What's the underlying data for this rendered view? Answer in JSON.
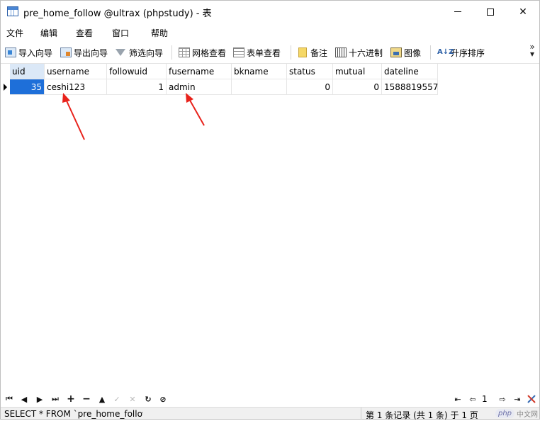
{
  "window": {
    "title": "pre_home_follow @ultrax (phpstudy) - 表",
    "minimize_icon": "minimize-icon",
    "maximize_icon": "maximize-icon",
    "close_glyph": "✕"
  },
  "menu": [
    "文件",
    "编辑",
    "查看",
    "窗口",
    "帮助"
  ],
  "toolbar": {
    "import": "导入向导",
    "export": "导出向导",
    "filter": "筛选向导",
    "grid_view": "网格查看",
    "form_view": "表单查看",
    "memo": "备注",
    "hex": "十六进制",
    "image": "图像",
    "sort": "升序排序",
    "sort_icon_text": "A↓Z",
    "more": "»"
  },
  "table": {
    "columns": [
      "uid",
      "username",
      "followuid",
      "fusername",
      "bkname",
      "status",
      "mutual",
      "dateline"
    ],
    "rows": [
      {
        "uid": "35",
        "username": "ceshi123",
        "followuid": "1",
        "fusername": "admin",
        "bkname": "",
        "status": "0",
        "mutual": "0",
        "dateline": "1588819557"
      }
    ],
    "selected_column": "uid"
  },
  "annotations": {
    "arrow_color": "#e8221b",
    "count": 2
  },
  "navigation": {
    "first": "⏮",
    "prev": "◀",
    "next": "▶",
    "last": "⏭",
    "add": "+",
    "delete": "−",
    "up": "▲",
    "apply": "✓",
    "cancel": "✕",
    "refresh": "↻",
    "stop": "⊘",
    "page_first": "⇤",
    "page_prev": "⇦",
    "page_number": "1",
    "page_next": "⇨",
    "page_last": "⇥",
    "tools_icon": "wrench-icon"
  },
  "status": {
    "sql": "SELECT * FROM `pre_home_follow",
    "record": "第 1 条记录 (共 1 条) 于 1 页",
    "watermark_logo": "php",
    "watermark_text": "中文网"
  }
}
